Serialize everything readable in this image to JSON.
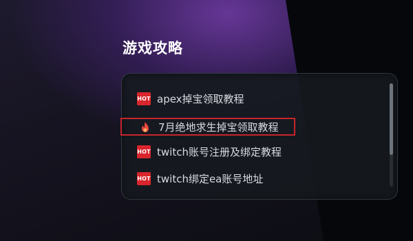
{
  "section": {
    "title": "游戏攻略"
  },
  "guides": [
    {
      "badge": "HOT",
      "label": "apex掉宝领取教程"
    },
    {
      "badge": "fire",
      "label": "7月绝地求生掉宝领取教程"
    },
    {
      "badge": "HOT",
      "label": "twitch账号注册及绑定教程"
    },
    {
      "badge": "HOT",
      "label": "twitch绑定ea账号地址"
    }
  ],
  "icons": {
    "hot_badge": "hot-badge-icon",
    "fire": "fire-icon"
  },
  "colors": {
    "accent_red": "#d8262c",
    "selection_border": "#c7252c",
    "text": "#d8dce2"
  }
}
